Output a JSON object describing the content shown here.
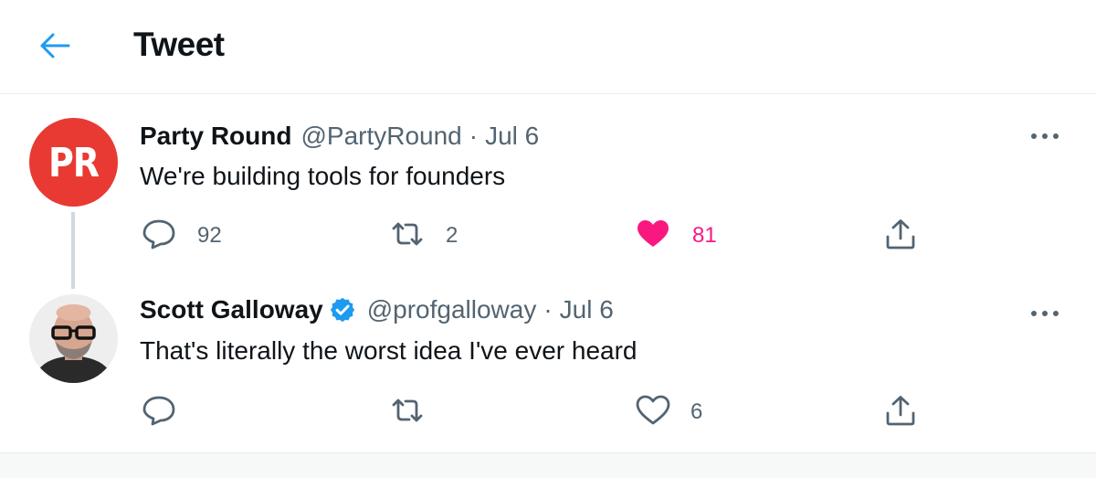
{
  "header": {
    "title": "Tweet",
    "back_icon": "arrow-left-icon",
    "accent": "#1d9bf0"
  },
  "tweets": [
    {
      "avatar_text": "PR",
      "avatar_color": "#e83a33",
      "display_name": "Party Round",
      "handle": "@PartyRound",
      "separator": "·",
      "date": "Jul 6",
      "verified": false,
      "text": "We're building tools for founders",
      "replies": "92",
      "retweets": "2",
      "likes": "81",
      "liked": true,
      "like_color": "#f91880"
    },
    {
      "avatar_text": "",
      "display_name": "Scott Galloway",
      "handle": "@profgalloway",
      "separator": "·",
      "date": "Jul 6",
      "verified": true,
      "verified_color": "#1d9bf0",
      "text": "That's literally the worst idea I've ever heard",
      "replies": "",
      "retweets": "",
      "likes": "6",
      "liked": false
    }
  ],
  "icons": [
    "arrow-left-icon",
    "reply-icon",
    "retweet-icon",
    "heart-icon",
    "share-icon",
    "more-icon",
    "verified-badge-icon"
  ]
}
